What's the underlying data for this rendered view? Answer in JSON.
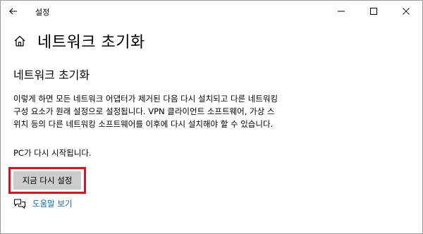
{
  "window": {
    "app_title": "설정"
  },
  "icons": {
    "back": "back-arrow-icon",
    "home": "home-icon",
    "help": "chat-help-icon",
    "minimize": "minimize-icon",
    "maximize": "maximize-icon",
    "close": "close-icon"
  },
  "header": {
    "title": "네트워크 초기화"
  },
  "main": {
    "section_title": "네트워크 초기화",
    "description": "이렇게 하면 모든 네트워크 어댑터가 제거된 다음 다시 설치되고 다른 네트워킹 구성 요소가 원래 설정으로 설정됩니다. VPN 클라이언트 소프트웨어, 가상 스위치 등의 다른 네트워킹 소프트웨어를 이후에 다시 설치해야 할 수 있습니다.",
    "restart_note": "PC가 다시 시작됩니다.",
    "reset_button_label": "지금 다시 설정",
    "help_link": "도움말 보기"
  },
  "colors": {
    "link": "#0066b4",
    "highlight": "#e0101c",
    "button_bg": "#cccccc"
  }
}
